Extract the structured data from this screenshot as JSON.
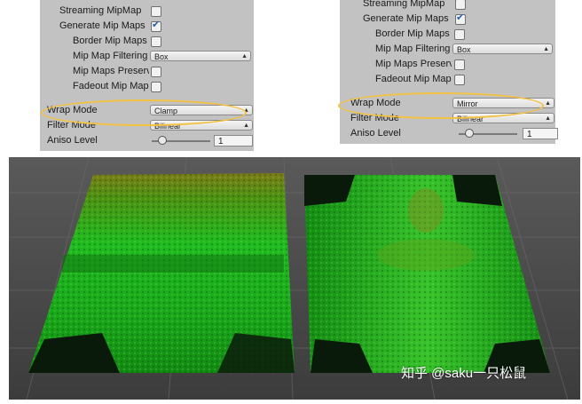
{
  "left_inspector": {
    "rows": [
      {
        "label": "Streaming MipMap",
        "checked": false
      },
      {
        "label": "Generate Mip Maps",
        "checked": true
      },
      {
        "label": "Border Mip Maps",
        "checked": false
      },
      {
        "label": "Mip Map Filtering",
        "value": "Box"
      },
      {
        "label": "Mip Maps Preserve",
        "checked": false
      },
      {
        "label": "Fadeout Mip Maps",
        "checked": false
      }
    ],
    "wrap_mode": {
      "label": "Wrap Mode",
      "value": "Clamp"
    },
    "filter_mode": {
      "label": "Filter Mode",
      "value": "Bilinear"
    },
    "aniso": {
      "label": "Aniso Level",
      "value": "1",
      "level": 0
    }
  },
  "right_inspector": {
    "rows": [
      {
        "label": "Streaming MipMap",
        "checked": false
      },
      {
        "label": "Generate Mip Maps",
        "checked": true
      },
      {
        "label": "Border Mip Maps",
        "checked": false
      },
      {
        "label": "Mip Map Filtering",
        "value": "Box"
      },
      {
        "label": "Mip Maps Preserve",
        "checked": false
      },
      {
        "label": "Fadeout Mip Maps",
        "checked": false
      }
    ],
    "wrap_mode": {
      "label": "Wrap Mode",
      "value": "Mirror"
    },
    "filter_mode": {
      "label": "Filter Mode",
      "value": "Bilinear"
    },
    "aniso": {
      "label": "Aniso Level",
      "value": "1",
      "level": 0
    }
  },
  "watermark": "知乎 @saku一只松鼠",
  "colors": {
    "inspector_bg": "#c2c2c2",
    "highlight": "#f3c243",
    "scene_bg": "#4b4b4b",
    "texture_green": "#1fb21f"
  }
}
